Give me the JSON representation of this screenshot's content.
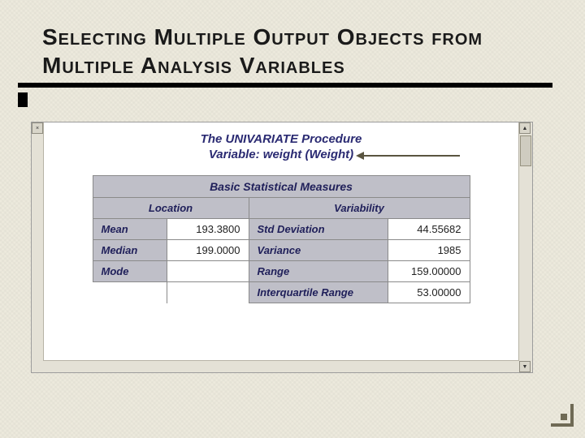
{
  "slide": {
    "title": "Selecting Multiple Output Objects from Multiple Analysis Variables"
  },
  "output": {
    "procedure_title": "The UNIVARIATE Procedure",
    "variable_line": "Variable: weight (Weight)",
    "table_title": "Basic Statistical Measures",
    "location_header": "Location",
    "variability_header": "Variability",
    "rows": {
      "mean_label": "Mean",
      "mean_value": "193.3800",
      "median_label": "Median",
      "median_value": "199.0000",
      "mode_label": "Mode",
      "mode_value": "",
      "std_label": "Std Deviation",
      "std_value": "44.55682",
      "var_label": "Variance",
      "var_value": "1985",
      "range_label": "Range",
      "range_value": "159.00000",
      "iqr_label": "Interquartile Range",
      "iqr_value": "53.00000"
    }
  },
  "chart_data": {
    "type": "table",
    "title": "Basic Statistical Measures",
    "variable": "weight (Weight)",
    "location": {
      "Mean": 193.38,
      "Median": 199.0,
      "Mode": null
    },
    "variability": {
      "Std Deviation": 44.55682,
      "Variance": 1985,
      "Range": 159.0,
      "Interquartile Range": 53.0
    }
  }
}
